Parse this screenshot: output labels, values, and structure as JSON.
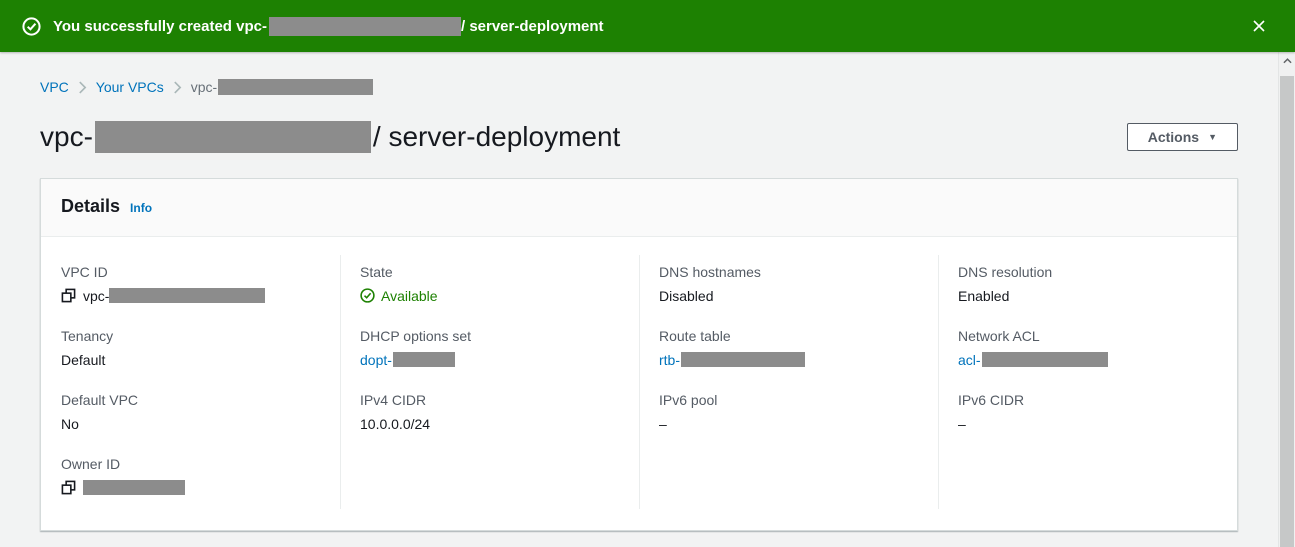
{
  "banner": {
    "message_prefix": "You successfully created vpc-",
    "message_suffix": "/ server-deployment",
    "background_color": "#1d8102",
    "icon": "success-checkmark-circle",
    "redacted": true
  },
  "breadcrumb": {
    "items": [
      {
        "label": "VPC",
        "link": true
      },
      {
        "label": "Your VPCs",
        "link": true
      },
      {
        "label": "vpc-",
        "link": false,
        "redacted": true
      }
    ]
  },
  "header": {
    "title_prefix": "vpc-",
    "title_suffix": " / server-deployment",
    "title_redacted": true,
    "actions_label": "Actions",
    "actions_caret": "▼"
  },
  "details": {
    "title": "Details",
    "info_label": "Info",
    "columns": [
      {
        "fields": [
          {
            "label": "VPC ID",
            "type": "copy",
            "value_prefix": "vpc-",
            "redacted": true
          },
          {
            "label": "Tenancy",
            "type": "text",
            "value": "Default"
          },
          {
            "label": "Default VPC",
            "type": "text",
            "value": "No"
          },
          {
            "label": "Owner ID",
            "type": "copy",
            "value_prefix": "",
            "redacted": true
          }
        ]
      },
      {
        "fields": [
          {
            "label": "State",
            "type": "status",
            "value": "Available",
            "status_color": "#1d8102"
          },
          {
            "label": "DHCP options set",
            "type": "link",
            "value_prefix": "dopt-",
            "redacted": true
          },
          {
            "label": "IPv4 CIDR",
            "type": "text",
            "value": "10.0.0.0/24"
          }
        ]
      },
      {
        "fields": [
          {
            "label": "DNS hostnames",
            "type": "text",
            "value": "Disabled"
          },
          {
            "label": "Route table",
            "type": "link",
            "value_prefix": "rtb-",
            "redacted": true
          },
          {
            "label": "IPv6 pool",
            "type": "text",
            "value": "–"
          }
        ]
      },
      {
        "fields": [
          {
            "label": "DNS resolution",
            "type": "text",
            "value": "Enabled"
          },
          {
            "label": "Network ACL",
            "type": "link",
            "value_prefix": "acl-",
            "redacted": true
          },
          {
            "label": "IPv6 CIDR",
            "type": "text",
            "value": "–"
          }
        ]
      }
    ]
  },
  "colors": {
    "success_green": "#1d8102",
    "link_blue": "#0073bb",
    "label_gray": "#545b64",
    "text_dark": "#16191f",
    "redaction_gray": "#8c8c8c",
    "page_background": "#f2f3f3",
    "card_border": "#d5dbdb"
  }
}
